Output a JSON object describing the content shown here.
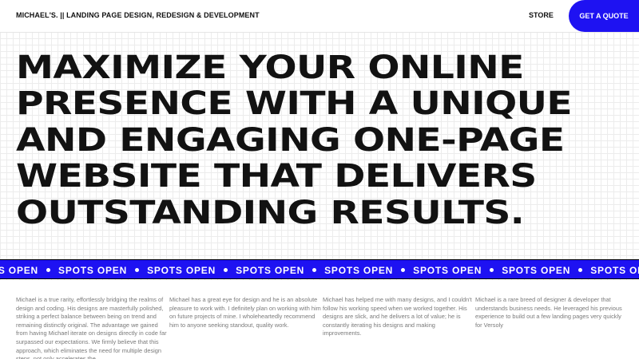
{
  "header": {
    "brand": "MICHAEL'S. || LANDING PAGE DESIGN, REDESIGN & DEVELOPMENT",
    "nav_store": "STORE",
    "cta_label": "GET A QUOTE"
  },
  "hero": {
    "lines": [
      "MAXIMIZE YOUR ONLINE",
      "PRESENCE WITH A UNIQUE",
      "AND ENGAGING ONE-PAGE",
      "WEBSITE THAT DELIVERS",
      "OUTSTANDING RESULTS."
    ]
  },
  "marquee": {
    "label": "SPOTS OPEN",
    "accent": "#1e12f2"
  },
  "testimonials": [
    "Michael is a true rarity, effortlessly bridging the realms of design and coding. His designs are masterfully polished, striking a perfect balance between being on trend and remaining distinctly original. The advantage we gained from having Michael iterate on designs directly in code far surpassed our expectations. We firmly believe that this approach, which eliminates the need for multiple design steps, not only accelerates the",
    "Michael has a great eye for design and he is an absolute pleasure to work with. I definitely plan on working with him on future projects of mine. I wholeheartedly recommend him to anyone seeking standout, quality work.",
    "Michael has helped me with many designs, and I couldn't follow his working speed when we worked together. His designs are slick, and he delivers a lot of value; he is constantly iterating his designs and making improvements.",
    "Michael is a rare breed of designer & developer that understands business needs. He leveraged his previous experience to build out a few landing pages very quickly for Versoly"
  ]
}
